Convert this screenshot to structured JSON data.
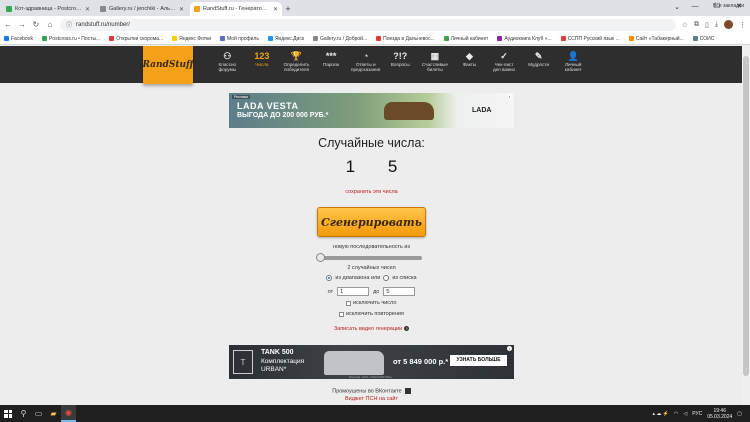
{
  "browser": {
    "tabs": [
      {
        "title": "Кот-здравница - Postcross.ru",
        "favicon_color": "#34a853",
        "active": false
      },
      {
        "title": "Gallery.ru / jenchiki - Альбом",
        "favicon_color": "#888888",
        "active": false
      },
      {
        "title": "RandStuff.ru - Генератор случ...",
        "favicon_color": "#f4a11a",
        "active": true
      }
    ],
    "url": "randstuff.ru/number/",
    "bookmarks": [
      {
        "label": "Facebook",
        "color": "#1877f2"
      },
      {
        "label": "Postcross.ru • Посты...",
        "color": "#34a853"
      },
      {
        "label": "Открытки скорома...",
        "color": "#e53935"
      },
      {
        "label": "Яндекс Фотки",
        "color": "#ffcc00"
      },
      {
        "label": "Мой профиль",
        "color": "#5c6bc0"
      },
      {
        "label": "Яндекс.Диск",
        "color": "#2196f3"
      },
      {
        "label": "Gallery.ru / Доброй...",
        "color": "#888888"
      },
      {
        "label": "Поезда в Дальневос...",
        "color": "#e53935"
      },
      {
        "label": "Личный кабинет",
        "color": "#43a047"
      },
      {
        "label": "Аудиокнига Клуб «...",
        "color": "#8e24aa"
      },
      {
        "label": "ССПП Русский язык ...",
        "color": "#e53935"
      },
      {
        "label": "Сайт «Табакерный...",
        "color": "#fb8c00"
      },
      {
        "label": "СОИС",
        "color": "#607d8b"
      }
    ],
    "all_bookmarks": "Все закладки"
  },
  "site": {
    "logo": "RandStuff",
    "nav": [
      {
        "icon": "⚇",
        "label": "Классно\nфорумы",
        "active": false
      },
      {
        "icon": "123",
        "label": "Числа",
        "active": true
      },
      {
        "icon": "🏆",
        "label": "Определить\nпобедителя",
        "active": false
      },
      {
        "icon": "***",
        "label": "Пароли",
        "active": false
      },
      {
        "icon": "◔",
        "label": "Ответы и\nпредсказания",
        "active": false
      },
      {
        "icon": "?!?",
        "label": "Вопросы",
        "active": false
      },
      {
        "icon": "▦",
        "label": "Счастливые\nбилеты",
        "active": false
      },
      {
        "icon": "◆",
        "label": "Факты",
        "active": false
      },
      {
        "icon": "✓",
        "label": "Чек-лист\nдел важно",
        "active": false
      },
      {
        "icon": "✎",
        "label": "Мудрости",
        "active": false
      },
      {
        "icon": "👤",
        "label": "Личный\nкабинет",
        "active": false
      }
    ]
  },
  "ad_top": {
    "tag": "Реклама",
    "headline": "LADA VESTA",
    "subline": "ВЫГОДА ДО 200 000 РУБ.*",
    "brand": "LADA"
  },
  "generator": {
    "title": "Случайные числа:",
    "numbers": "1 5",
    "save_link": "сохранить эти числа",
    "generate_button": "Сгенерировать",
    "sequence_label": "новую последовательность из",
    "count_label": "2 случайных чисел",
    "radio_range": "из диапазона или",
    "radio_list": "из списка",
    "from_label": "от",
    "from_value": "1",
    "to_label": "до",
    "to_value": "5",
    "exclude_number": "исключить число",
    "exclude_repeats": "исключить повторения",
    "video_link": "Записать видео генерации"
  },
  "ad_bottom": {
    "logo": "T",
    "line1": "TANK 500",
    "line2": "Комплектация",
    "line3": "URBAN*",
    "price": "от 5 849 000 р.*",
    "cta": "УЗНАТЬ БОЛЬШЕ",
    "fine_print": "Реклама. ООО «ТАНК МОТОРС»"
  },
  "footer": {
    "share": "Промоушены во ВКонтакте",
    "pc_link": "Виджет ПСН на сайт"
  },
  "taskbar": {
    "lang": "РУС",
    "time": "19:46",
    "date": "05.03.2024"
  }
}
